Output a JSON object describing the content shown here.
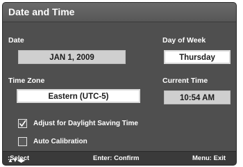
{
  "window": {
    "title": "Date and Time"
  },
  "date": {
    "label": "Date",
    "value": "JAN 1, 2009"
  },
  "day_of_week": {
    "label": "Day of Week",
    "value": "Thursday"
  },
  "time_zone": {
    "label": "Time Zone",
    "value": "Eastern (UTC-5)"
  },
  "current_time": {
    "label": "Current Time",
    "value": "10:54 AM"
  },
  "options": {
    "daylight_saving": {
      "label": "Adjust for Daylight Saving Time",
      "checked": true
    },
    "auto_calibration": {
      "label": "Auto Calibration",
      "checked": false
    }
  },
  "footer": {
    "navigate_glyphs": "▲▼◀▶",
    "navigate_label": ":Select",
    "enter_label": "Enter: Confirm",
    "menu_label": "Menu: Exit"
  }
}
